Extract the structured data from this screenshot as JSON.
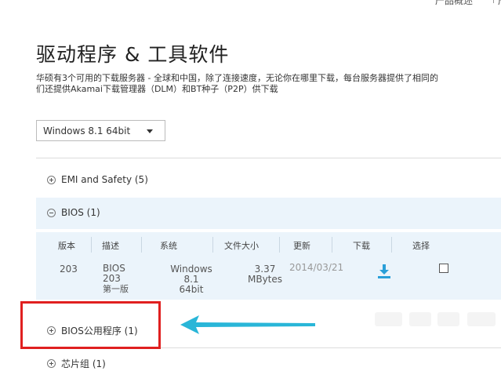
{
  "topnav": {
    "item": "产品概述",
    "next": "产"
  },
  "page": {
    "title": "驱动程序 & 工具软件",
    "desc_line1": "华硕有3个可用的下载服务器 - 全球和中国，除了连接速度，无论你在哪里下载，每台服务器提供了相同的",
    "desc_line2": "们还提供Akamai下载管理器（DLM）和BT种子（P2P）供下载"
  },
  "os_select": {
    "value": "Windows 8.1 64bit"
  },
  "sections": [
    {
      "label": "EMI and Safety  (5)",
      "state": "collapsed"
    },
    {
      "label": "BIOS (1)",
      "state": "expanded"
    },
    {
      "label": "BIOS公用程序 (1)",
      "state": "collapsed"
    },
    {
      "label": "芯片组 (1)",
      "state": "collapsed"
    }
  ],
  "table": {
    "headers": [
      "版本",
      "描述",
      "系统",
      "文件大小",
      "更新",
      "下载",
      "选择"
    ],
    "row": {
      "version": "203",
      "desc1": "BIOS",
      "desc2": "203",
      "desc3": "第一版",
      "os1": "Windows 8.1",
      "os2": "64bit",
      "size1": "3.37",
      "size2": "MBytes",
      "date": "2014/03/21"
    }
  },
  "colors": {
    "highlight_box": "#e02020",
    "arrow": "#29b6d8",
    "download_icon": "#2a9fd8",
    "row_bg": "#ebf4fb"
  },
  "icons": {
    "expand": "plus-circle-icon",
    "collapse": "minus-circle-icon",
    "download": "download-icon",
    "dropdown": "chevron-down-icon"
  }
}
